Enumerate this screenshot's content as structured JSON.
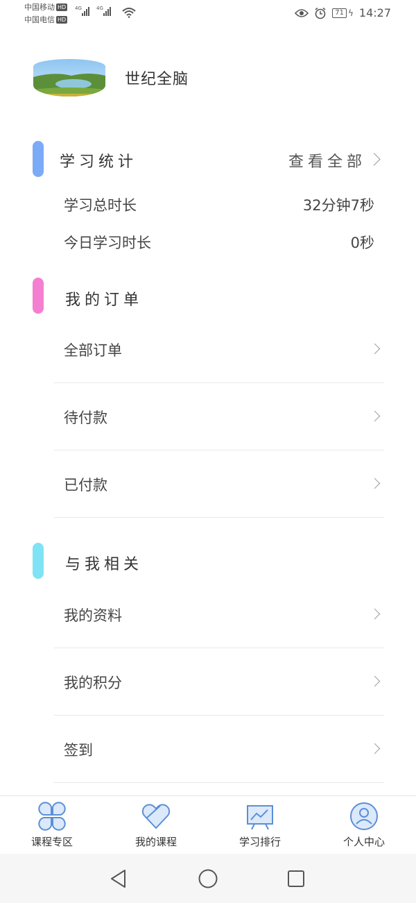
{
  "status_bar": {
    "carrier1": "中国移动",
    "carrier2": "中国电信",
    "hd": "HD",
    "network": "4G",
    "battery": "71",
    "time": "14:27"
  },
  "profile": {
    "username": "世纪全脑"
  },
  "study_stats": {
    "title": "学习统计",
    "see_all": "查看全部",
    "total_label": "学习总时长",
    "total_value": "32分钟7秒",
    "today_label": "今日学习时长",
    "today_value": "0秒"
  },
  "orders": {
    "title": "我的订单",
    "items": [
      {
        "label": "全部订单"
      },
      {
        "label": "待付款"
      },
      {
        "label": "已付款"
      }
    ]
  },
  "related": {
    "title": "与我相关",
    "items": [
      {
        "label": "我的资料"
      },
      {
        "label": "我的积分"
      },
      {
        "label": "签到"
      }
    ]
  },
  "tabbar": {
    "items": [
      {
        "label": "课程专区",
        "icon": "clover-grid-icon"
      },
      {
        "label": "我的课程",
        "icon": "heart-tag-icon"
      },
      {
        "label": "学习排行",
        "icon": "chart-board-icon"
      },
      {
        "label": "个人中心",
        "icon": "person-icon"
      }
    ]
  },
  "colors": {
    "accent_blue": "#7baaf7",
    "accent_pink": "#f47fd1",
    "accent_cyan": "#7fe3f5",
    "tab_icon": "#5b8fd6"
  }
}
